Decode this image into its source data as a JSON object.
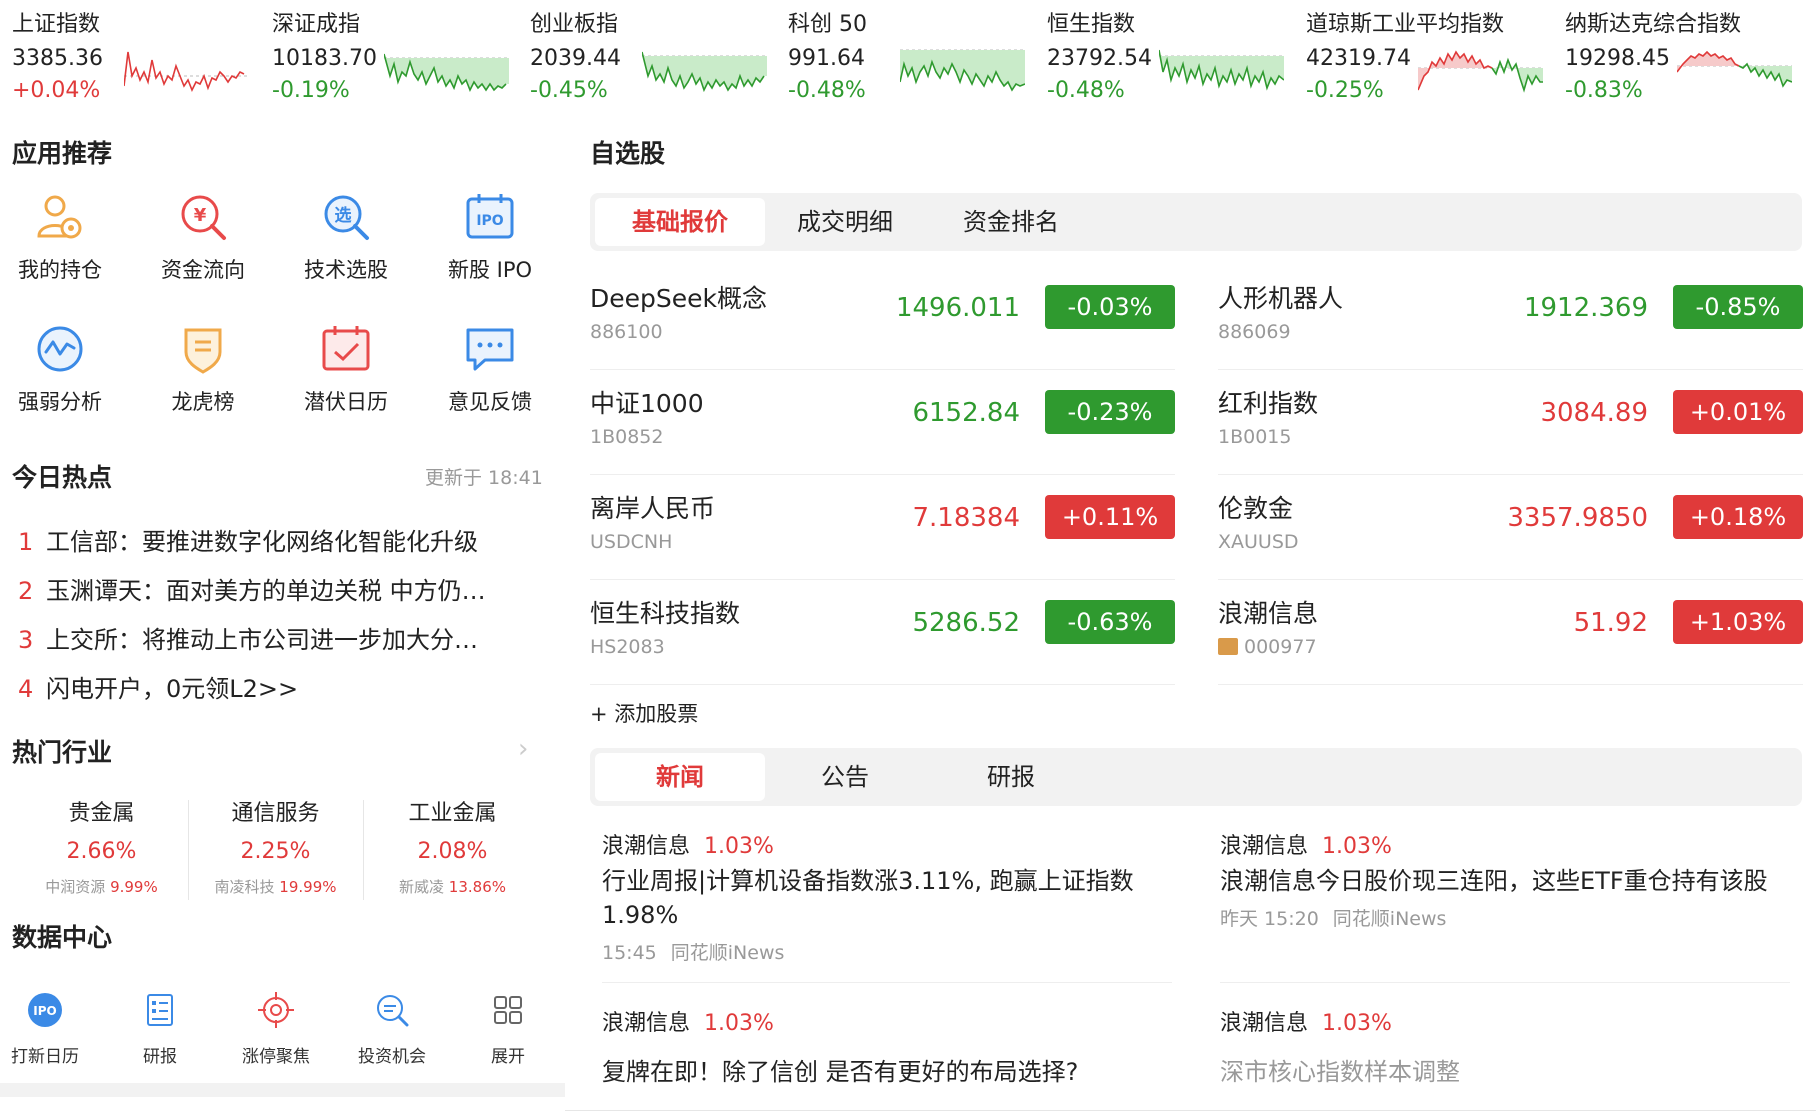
{
  "indices": [
    {
      "name": "上证指数",
      "value": "3385.36",
      "change": "+0.04%",
      "dir": "up"
    },
    {
      "name": "深证成指",
      "value": "10183.70",
      "change": "-0.19%",
      "dir": "down"
    },
    {
      "name": "创业板指",
      "value": "2039.44",
      "change": "-0.45%",
      "dir": "down"
    },
    {
      "name": "科创 50",
      "value": "991.64",
      "change": "-0.48%",
      "dir": "down"
    },
    {
      "name": "恒生指数",
      "value": "23792.54",
      "change": "-0.48%",
      "dir": "down"
    },
    {
      "name": "道琼斯工业平均指数",
      "value": "42319.74",
      "change": "-0.25%",
      "dir": "down"
    },
    {
      "name": "纳斯达克综合指数",
      "value": "19298.45",
      "change": "-0.83%",
      "dir": "down"
    }
  ],
  "apps": {
    "title": "应用推荐",
    "items": [
      {
        "label": "我的持仓",
        "icon": "holdings-icon"
      },
      {
        "label": "资金流向",
        "icon": "money-flow-icon"
      },
      {
        "label": "技术选股",
        "icon": "stock-picker-icon"
      },
      {
        "label": "新股 IPO",
        "icon": "ipo-icon",
        "icon_text": "IPO"
      },
      {
        "label": "强弱分析",
        "icon": "strength-analysis-icon"
      },
      {
        "label": "龙虎榜",
        "icon": "dragon-tiger-icon"
      },
      {
        "label": "潜伏日历",
        "icon": "calendar-icon"
      },
      {
        "label": "意见反馈",
        "icon": "feedback-icon"
      }
    ],
    "icon_glyph_money": "¥",
    "icon_glyph_pick": "选"
  },
  "hot": {
    "title": "今日热点",
    "updated": "更新于 18:41",
    "items": [
      {
        "num": "1",
        "text": "工信部：要推进数字化网络化智能化升级"
      },
      {
        "num": "2",
        "text": "玉渊谭天：面对美方的单边关税 中方仍…"
      },
      {
        "num": "3",
        "text": "上交所：将推动上市公司进一步加大分…"
      },
      {
        "num": "4",
        "text": "闪电开户，0元领L2>>"
      }
    ]
  },
  "industry": {
    "title": "热门行业",
    "items": [
      {
        "name": "贵金属",
        "pct": "2.66%",
        "leader": "中润资源",
        "leader_pct": "9.99%"
      },
      {
        "name": "通信服务",
        "pct": "2.25%",
        "leader": "南凌科技",
        "leader_pct": "19.99%"
      },
      {
        "name": "工业金属",
        "pct": "2.08%",
        "leader": "新威凌",
        "leader_pct": "13.86%"
      }
    ]
  },
  "datacenter": {
    "title": "数据中心",
    "items": [
      {
        "label": "打新日历",
        "icon": "ipo-badge-icon",
        "icon_text": "IPO"
      },
      {
        "label": "研报",
        "icon": "report-icon"
      },
      {
        "label": "涨停聚焦",
        "icon": "target-icon"
      },
      {
        "label": "投资机会",
        "icon": "search-opportunity-icon"
      },
      {
        "label": "展开",
        "icon": "grid-icon"
      }
    ]
  },
  "watchlist": {
    "title": "自选股",
    "tabs": [
      "基础报价",
      "成交明细",
      "资金排名"
    ],
    "stocks": [
      {
        "name": "DeepSeek概念",
        "code": "886100",
        "price": "1496.011",
        "change": "-0.03%",
        "dir": "down"
      },
      {
        "name": "人形机器人",
        "code": "886069",
        "price": "1912.369",
        "change": "-0.85%",
        "dir": "down"
      },
      {
        "name": "中证1000",
        "code": "1B0852",
        "price": "6152.84",
        "change": "-0.23%",
        "dir": "down"
      },
      {
        "name": "红利指数",
        "code": "1B0015",
        "price": "3084.89",
        "change": "+0.01%",
        "dir": "up"
      },
      {
        "name": "离岸人民币",
        "code": "USDCNH",
        "price": "7.18384",
        "change": "+0.11%",
        "dir": "up"
      },
      {
        "name": "伦敦金",
        "code": "XAUUSD",
        "price": "3357.9850",
        "change": "+0.18%",
        "dir": "up"
      },
      {
        "name": "恒生科技指数",
        "code": "HS2083",
        "price": "5286.52",
        "change": "-0.63%",
        "dir": "down"
      },
      {
        "name": "浪潮信息",
        "code": "000977",
        "price": "51.92",
        "change": "+1.03%",
        "dir": "up",
        "badge": "融"
      }
    ],
    "add_label": "+ 添加股票"
  },
  "news": {
    "tabs": [
      "新闻",
      "公告",
      "研报"
    ],
    "items": [
      {
        "stock": "浪潮信息",
        "pct": "1.03%",
        "title": "行业周报|计算机设备指数涨3.11%, 跑赢上证指数1.98%",
        "time": "15:45",
        "source": "同花顺iNews"
      },
      {
        "stock": "浪潮信息",
        "pct": "1.03%",
        "title": "浪潮信息今日股价现三连阳，这些ETF重仓持有该股",
        "time": "昨天 15:20",
        "source": "同花顺iNews"
      },
      {
        "stock": "浪潮信息",
        "pct": "1.03%",
        "title": "复牌在即！除了信创 是否有更好的布局选择?"
      },
      {
        "stock": "浪潮信息",
        "pct": "1.03%",
        "title": "深市核心指数样本调整"
      }
    ]
  },
  "colors": {
    "up": "#e03a3a",
    "down": "#2f9a2f",
    "accent": "#e03a3a"
  }
}
